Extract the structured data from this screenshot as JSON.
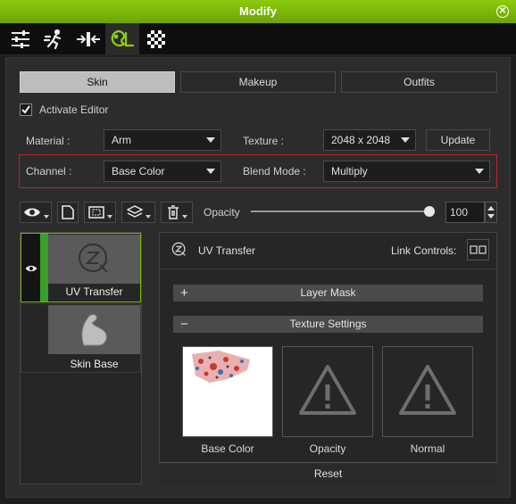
{
  "window": {
    "title": "Modify"
  },
  "main_tabs": [
    "sliders-icon",
    "motion-icon",
    "align-icon",
    "appearance-editor-icon",
    "checker-icon"
  ],
  "sub_tabs": {
    "skin": "Skin",
    "makeup": "Makeup",
    "outfits": "Outfits"
  },
  "activate_editor": {
    "label": "Activate Editor",
    "checked": true
  },
  "material": {
    "label": "Material :",
    "value": "Arm"
  },
  "texture": {
    "label": "Texture :",
    "value": "2048 x 2048",
    "update_label": "Update"
  },
  "channel": {
    "label": "Channel :",
    "value": "Base Color"
  },
  "blend_mode": {
    "label": "Blend Mode :",
    "value": "Multiply"
  },
  "opacity": {
    "label": "Opacity",
    "value": "100",
    "slider_fraction": 1.0
  },
  "layers": [
    {
      "name": "UV Transfer",
      "visible": true,
      "selected": true
    },
    {
      "name": "Skin Base",
      "visible": false,
      "selected": false
    }
  ],
  "detail": {
    "title": "UV Transfer",
    "link_controls_label": "Link Controls:",
    "layer_mask_label": "Layer Mask",
    "texture_settings_label": "Texture Settings",
    "textures": [
      {
        "caption": "Base Color"
      },
      {
        "caption": "Opacity"
      },
      {
        "caption": "Normal"
      }
    ],
    "reset_label": "Reset"
  },
  "colors": {
    "accent_green": "#7ab80a",
    "highlight_red": "#c2242a",
    "selected_layer_border": "#7ab80a"
  }
}
